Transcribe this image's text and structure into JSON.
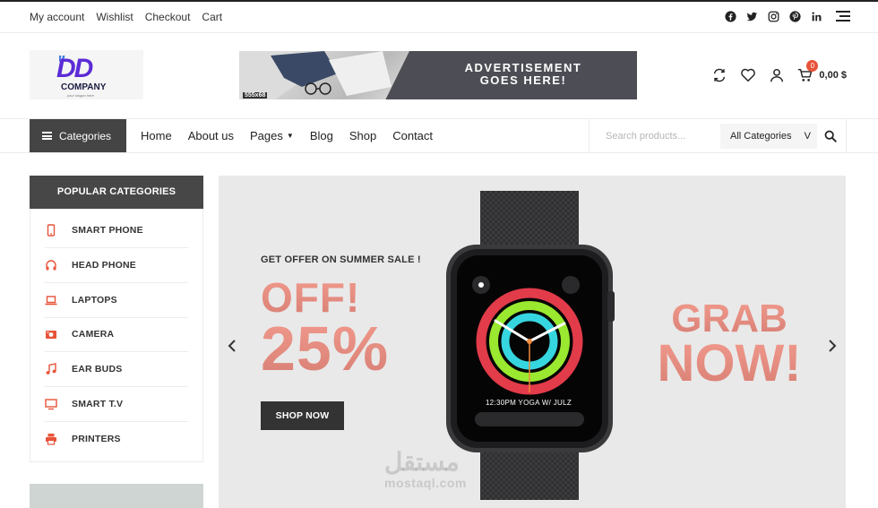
{
  "topbar": {
    "links": [
      "My account",
      "Wishlist",
      "Checkout",
      "Cart"
    ],
    "socials": [
      "facebook-icon",
      "twitter-icon",
      "instagram-icon",
      "pinterest-icon",
      "linkedin-icon",
      "menu-icon"
    ]
  },
  "header": {
    "logo": {
      "mark": "DD",
      "company": "COMPANY",
      "slogan": "your slogan here"
    },
    "ad": {
      "size": "555x68",
      "line1": "ADVERTISEMENT",
      "line2": "GOES HERE!"
    },
    "cart": {
      "count": "0",
      "total": "0,00 $"
    }
  },
  "nav": {
    "categories_label": "Categories",
    "menu": [
      "Home",
      "About us",
      "Pages",
      "Blog",
      "Shop",
      "Contact"
    ],
    "search": {
      "placeholder": "Search products...",
      "category": "All Categories",
      "caret": "V"
    }
  },
  "sidebar": {
    "title": "POPULAR CATEGORIES",
    "items": [
      {
        "label": "SMART PHONE",
        "icon": "phone-icon"
      },
      {
        "label": "HEAD PHONE",
        "icon": "headphone-icon"
      },
      {
        "label": "LAPTOPS",
        "icon": "laptop-icon"
      },
      {
        "label": "CAMERA",
        "icon": "camera-icon"
      },
      {
        "label": "EAR BUDS",
        "icon": "music-icon"
      },
      {
        "label": "SMART T.V",
        "icon": "tv-icon"
      },
      {
        "label": "PRINTERS",
        "icon": "printer-icon"
      }
    ]
  },
  "hero": {
    "offer": "GET OFFER ON SUMMER SALE !",
    "off": "OFF!",
    "percent": "25%",
    "button": "SHOP NOW",
    "grab": "GRAB",
    "now": "NOW!",
    "watch_text": "12:30PM YOGA W/ JULZ",
    "watermark_ar": "مستقل",
    "watermark_lat": "mostaql.com"
  },
  "colors": {
    "accent": "#e8533a",
    "dark": "#444444",
    "salmon": "#ef8e83"
  }
}
